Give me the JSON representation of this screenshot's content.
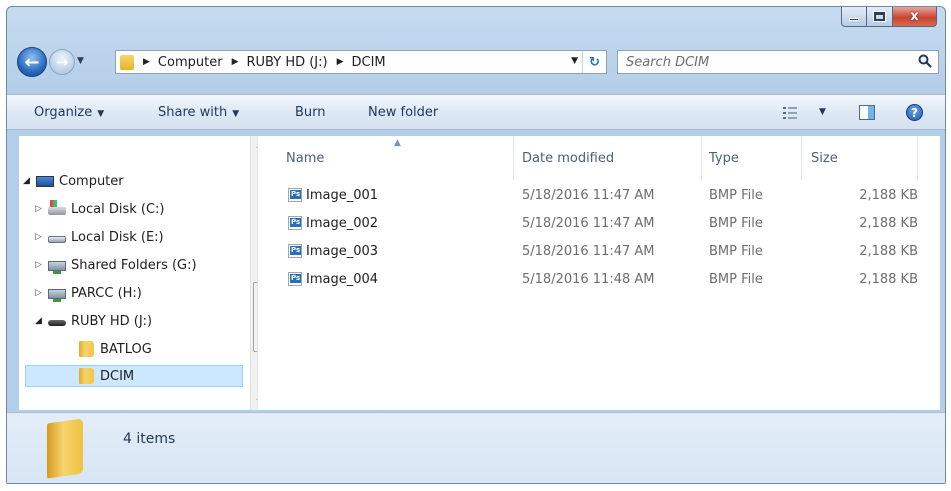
{
  "window": {
    "caption": {
      "minimize": "",
      "maximize": "",
      "close": "x"
    }
  },
  "address": {
    "crumbs": [
      "Computer",
      "RUBY HD (J:)",
      "DCIM"
    ],
    "search_placeholder": "Search DCIM"
  },
  "toolbar": {
    "organize": "Organize",
    "share_with": "Share with",
    "burn": "Burn",
    "new_folder": "New folder",
    "help": "?"
  },
  "tree": [
    {
      "label": "Computer",
      "icon": "computer-icon",
      "expanded": true
    },
    {
      "label": "Local Disk (C:)",
      "icon": "windows-disk-icon",
      "expanded": false
    },
    {
      "label": "Local Disk (E:)",
      "icon": "disk-icon",
      "expanded": false
    },
    {
      "label": "Shared Folders (G:)",
      "icon": "network-drive-icon",
      "expanded": false
    },
    {
      "label": "PARCC (H:)",
      "icon": "network-drive-icon",
      "expanded": false
    },
    {
      "label": "RUBY HD (J:)",
      "icon": "usb-drive-icon",
      "expanded": true
    },
    {
      "label": "BATLOG",
      "icon": "folder-icon"
    },
    {
      "label": "DCIM",
      "icon": "folder-icon",
      "selected": true
    }
  ],
  "columns": {
    "name": "Name",
    "date_modified": "Date modified",
    "type": "Type",
    "size": "Size"
  },
  "files": [
    {
      "name": "Image_001",
      "date": "5/18/2016 11:47 AM",
      "type": "BMP File",
      "size": "2,188 KB"
    },
    {
      "name": "Image_002",
      "date": "5/18/2016 11:47 AM",
      "type": "BMP File",
      "size": "2,188 KB"
    },
    {
      "name": "Image_003",
      "date": "5/18/2016 11:47 AM",
      "type": "BMP File",
      "size": "2,188 KB"
    },
    {
      "name": "Image_004",
      "date": "5/18/2016 11:48 AM",
      "type": "BMP File",
      "size": "2,188 KB"
    }
  ],
  "details": {
    "item_count": "4 items"
  }
}
